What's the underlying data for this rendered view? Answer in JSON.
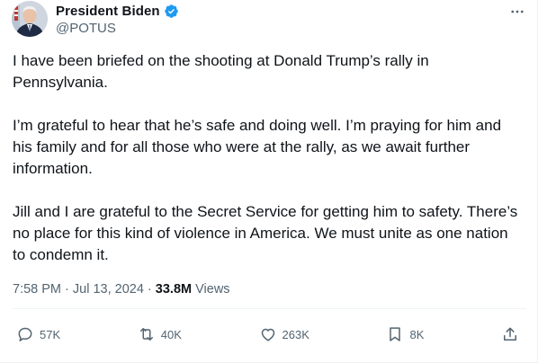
{
  "author": {
    "display_name": "President Biden",
    "handle": "@POTUS",
    "verified_icon": "verified-badge-icon",
    "verified_color": "#1d9bf0"
  },
  "post": {
    "paragraphs": [
      "I have been briefed on the shooting at Donald Trump’s rally in Pennsylvania.",
      "I’m grateful to hear that he’s safe and doing well. I’m praying for him and his family and for all those who were at the rally, as we await further information.",
      "Jill and I are grateful to the Secret Service for getting him to safety. There’s no place for this kind of violence in America. We must unite as one nation to condemn it."
    ],
    "time": "7:58 PM",
    "date": "Jul 13, 2024",
    "separator": " · ",
    "views_count": "33.8M",
    "views_label": "Views"
  },
  "actions": {
    "replies": "57K",
    "reposts": "40K",
    "likes": "263K",
    "bookmarks": "8K"
  },
  "colors": {
    "text": "#0f1419",
    "secondary": "#536471",
    "divider": "#eff3f4"
  }
}
